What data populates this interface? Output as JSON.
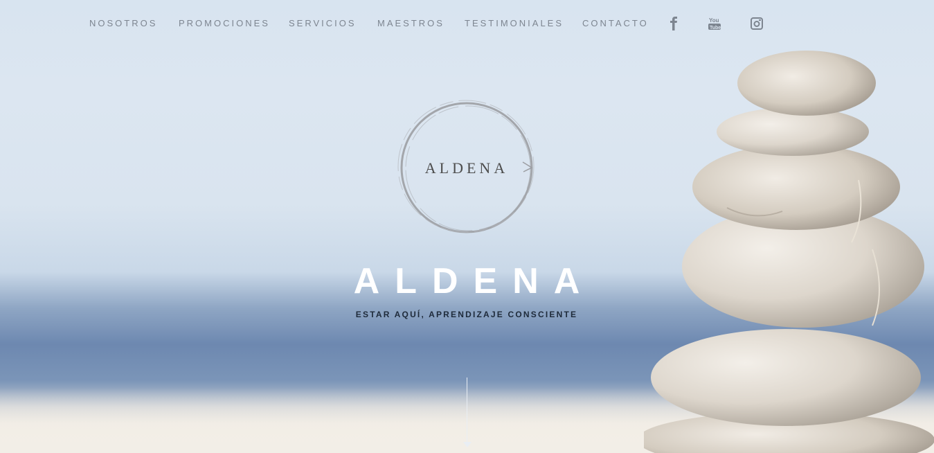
{
  "nav": {
    "items": [
      {
        "label": "NOSOTROS"
      },
      {
        "label": "PROMOCIONES"
      },
      {
        "label": "SERVICIOS"
      },
      {
        "label": "MAESTROS"
      },
      {
        "label": "TESTIMONIALES"
      },
      {
        "label": "CONTACTO"
      }
    ],
    "social": [
      "facebook-icon",
      "youtube-icon",
      "instagram-icon"
    ]
  },
  "logo": {
    "text": "ALDENA"
  },
  "hero": {
    "title": "ALDENA",
    "tagline": "ESTAR AQUÍ, APRENDIZAJE CONSCIENTE"
  },
  "colors": {
    "nav_text": "#7d8590",
    "title": "#ffffff",
    "tagline": "#1e2a3a",
    "sky": "#dce6f1",
    "sea": "#6d88b0"
  }
}
